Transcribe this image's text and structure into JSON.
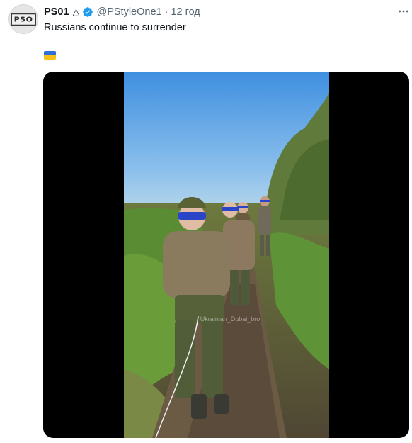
{
  "author": {
    "avatar_logo": "PSO",
    "display_name": "PS01",
    "name_mark": "△",
    "handle": "@PStyleOne1",
    "time": "12 год",
    "verified_color": "#1d9bf0"
  },
  "tweet": {
    "text": "Russians continue to surrender",
    "flag": "ukraine-flag-icon"
  },
  "media": {
    "type": "video",
    "background": "#000000",
    "watermark": "Ukrainian_Dubai_bro"
  },
  "colors": {
    "text": "#0f1419",
    "secondary": "#536471"
  }
}
